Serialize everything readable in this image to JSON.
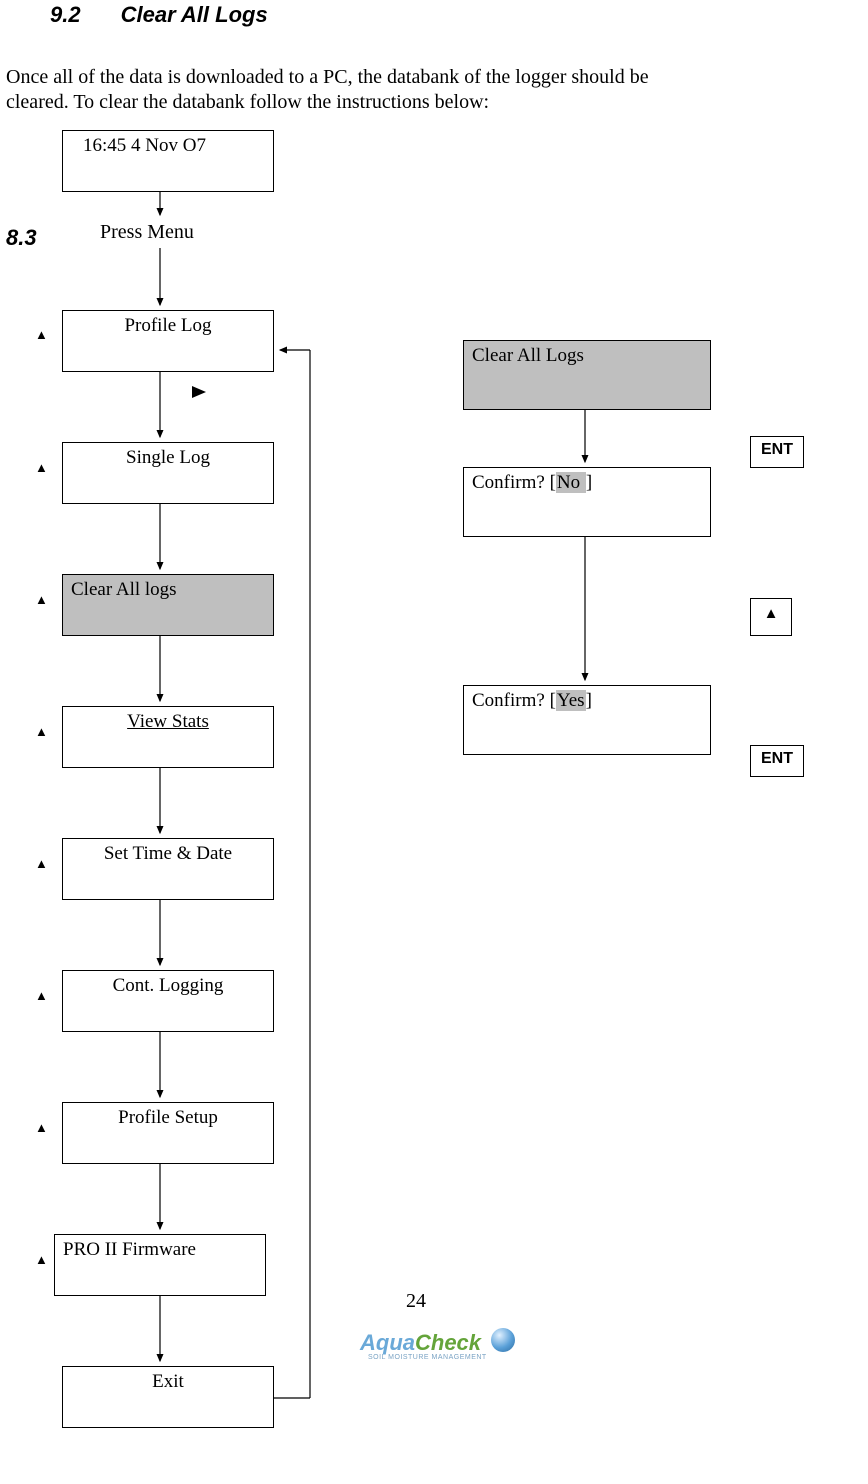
{
  "heading": {
    "num": "9.2",
    "title": "Clear All Logs"
  },
  "intro": "Once all of the data is downloaded to a PC, the databank of the logger should be\ncleared.  To clear the databank follow the instructions below:",
  "side": "8.3",
  "press_menu": "Press Menu",
  "screens": {
    "home": "16:45  4 Nov O7",
    "menu": [
      "Profile Log",
      "Single Log",
      "Clear All logs",
      "View Stats",
      "Set Time & Date",
      "Cont. Logging",
      "Profile Setup",
      "PRO II Firmware",
      "Exit"
    ],
    "right_top": "Clear    All Logs",
    "confirm_no": {
      "q": "Confirm?   [",
      "val": "No ",
      "end": "]"
    },
    "confirm_yes": {
      "q": "Confirm?  [",
      "val": "Yes",
      "end": "]"
    }
  },
  "buttons": {
    "ent": "ENT",
    "up": "▲"
  },
  "page_number": "24",
  "logo": {
    "aqua": "Aqua",
    "check": "Check",
    "sub": "SOIL MOISTURE MANAGEMENT"
  }
}
